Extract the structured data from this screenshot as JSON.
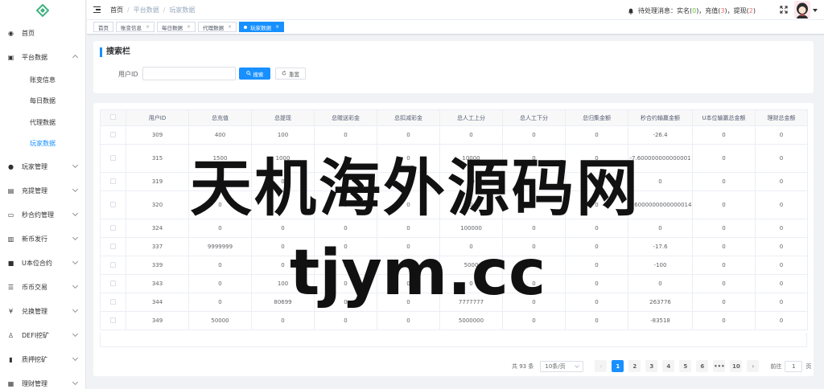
{
  "sidebar": {
    "items": [
      {
        "label": "首页",
        "icon": "dashboard-icon"
      },
      {
        "label": "平台数据",
        "icon": "data-icon",
        "expanded": true,
        "children": [
          "账变信息",
          "每日数据",
          "代理数据",
          "玩家数据"
        ],
        "active_child": "玩家数据"
      },
      {
        "label": "玩家管理",
        "icon": "user-icon"
      },
      {
        "label": "充提管理",
        "icon": "wallet-icon"
      },
      {
        "label": "秒合约管理",
        "icon": "contract-icon"
      },
      {
        "label": "新币发行",
        "icon": "coin-icon"
      },
      {
        "label": "U本位合约",
        "icon": "u-contract-icon"
      },
      {
        "label": "币币交易",
        "icon": "trade-icon"
      },
      {
        "label": "兑换管理",
        "icon": "yen-icon"
      },
      {
        "label": "DEFI挖矿",
        "icon": "defi-icon"
      },
      {
        "label": "质押挖矿",
        "icon": "pledge-icon"
      },
      {
        "label": "理财管理",
        "icon": "finance-icon"
      }
    ]
  },
  "header": {
    "breadcrumb": [
      "首页",
      "平台数据",
      "玩家数据"
    ],
    "notice_prefix": "待处理消息：实名(",
    "notice_realname": "0",
    "notice_mid1": ")，充值(",
    "notice_recharge": "3",
    "notice_mid2": ")，提现(",
    "notice_withdraw": "2",
    "notice_suffix": ")"
  },
  "tags": [
    {
      "label": "首页",
      "active": false
    },
    {
      "label": "账变信息",
      "active": false
    },
    {
      "label": "每日数据",
      "active": false
    },
    {
      "label": "代理数据",
      "active": false
    },
    {
      "label": "玩家数据",
      "active": true
    }
  ],
  "search": {
    "title": "搜索栏",
    "user_id_label": "用户ID",
    "user_id_value": "",
    "search_label": "搜索",
    "reset_label": "重置"
  },
  "table": {
    "columns": [
      "用户ID",
      "总充值",
      "总提现",
      "总赠送彩金",
      "总扣减彩金",
      "总人工上分",
      "总人工下分",
      "总归集金额",
      "秒合约输赢金额",
      "U本位输赢总金额",
      "理财总金额"
    ],
    "rows": [
      [
        "309",
        "400",
        "100",
        "0",
        "0",
        "0",
        "0",
        "0",
        "-26.4",
        "0",
        "0"
      ],
      [
        "315",
        "1500",
        "1000",
        "0",
        "0",
        "10000",
        "0",
        "0",
        "-7.600000000000001",
        "0",
        "0"
      ],
      [
        "319",
        "0",
        "0",
        "0",
        "0",
        "49",
        "0",
        "0",
        "0",
        "0",
        "0"
      ],
      [
        "320",
        "0",
        "0",
        "0",
        "0",
        "0",
        "0",
        "0",
        "3.6000000000000014",
        "0",
        "0"
      ],
      [
        "324",
        "0",
        "0",
        "0",
        "0",
        "100000",
        "0",
        "0",
        "0",
        "0",
        "0"
      ],
      [
        "337",
        "9999999",
        "0",
        "0",
        "0",
        "0",
        "0",
        "0",
        "-17.6",
        "0",
        "0"
      ],
      [
        "339",
        "0",
        "0",
        "0",
        "0",
        "5000",
        "0",
        "0",
        "-100",
        "0",
        "0"
      ],
      [
        "343",
        "0",
        "100",
        "0",
        "0",
        "0",
        "0",
        "0",
        "0",
        "0",
        "0"
      ],
      [
        "344",
        "0",
        "80699",
        "0",
        "0",
        "7777777",
        "0",
        "0",
        "263776",
        "0",
        "0"
      ],
      [
        "349",
        "50000",
        "0",
        "0",
        "0",
        "5000000",
        "0",
        "0",
        "-83518",
        "0",
        "0"
      ]
    ],
    "tall_rows": [
      1,
      3
    ]
  },
  "pagination": {
    "total": "共 93 条",
    "page_size": "10条/页",
    "pages": [
      "1",
      "2",
      "3",
      "4",
      "5",
      "6",
      "•••",
      "10"
    ],
    "current": "1",
    "goto_label": "前往",
    "goto_value": "1",
    "page_unit": "页"
  },
  "watermark": {
    "line1": "天机海外源码网",
    "line2": "tjym.cc"
  },
  "colors": {
    "primary": "#1890ff",
    "danger": "#f56c6c",
    "success": "#67c23a"
  }
}
